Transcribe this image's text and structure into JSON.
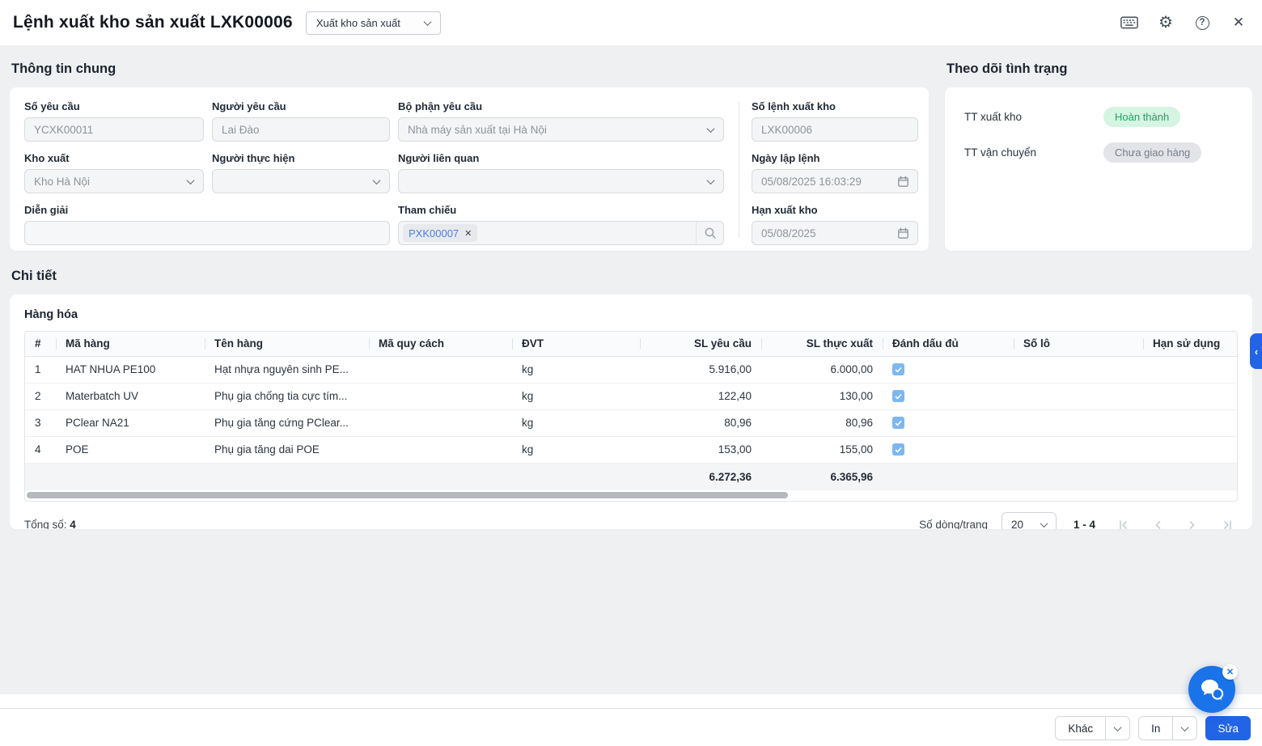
{
  "colors": {
    "primary": "#2264e5",
    "page_bg": "#eef0f2",
    "badge_green_bg": "#d5f4e2",
    "badge_green_text": "#21a263",
    "badge_gray_bg": "#e2e4e8",
    "badge_gray_text": "#767d88",
    "tag_text": "#4d7fe0",
    "checkbox_blue": "#7db7f0"
  },
  "topbar": {
    "title": "Lệnh xuất kho sản xuất LXK00006",
    "type_select_value": "Xuất kho sản xuất",
    "icons": [
      "keyboard-icon",
      "settings-icon",
      "help-icon",
      "close-icon"
    ]
  },
  "general": {
    "section_title": "Thông tin chung",
    "so_yeu_cau_label": "Số yêu cầu",
    "so_yeu_cau_value": "YCXK00011",
    "nguoi_yeu_cau_label": "Người yêu cầu",
    "nguoi_yeu_cau_value": "Lai Đào",
    "bo_phan_label": "Bộ phận yêu cầu",
    "bo_phan_value": "Nhà máy sản xuất tại Hà Nội",
    "kho_xuat_label": "Kho xuất",
    "kho_xuat_value": "Kho Hà Nội",
    "nguoi_thuc_hien_label": "Người thực hiện",
    "nguoi_thuc_hien_value": "",
    "nguoi_lien_quan_label": "Người liên quan",
    "nguoi_lien_quan_value": "",
    "dien_giai_label": "Diễn giải",
    "dien_giai_value": "",
    "tham_chieu_label": "Tham chiếu",
    "tham_chieu_tag": "PXK00007",
    "so_lenh_label": "Số lệnh xuất kho",
    "so_lenh_value": "LXK00006",
    "ngay_lap_label": "Ngày lập lệnh",
    "ngay_lap_value": "05/08/2025 16:03:29",
    "han_xuat_label": "Hạn xuất kho",
    "han_xuat_value": "05/08/2025"
  },
  "status": {
    "section_title": "Theo dõi tình trạng",
    "rows": [
      {
        "label": "TT xuất kho",
        "badge": "Hoàn thành",
        "tone": "green"
      },
      {
        "label": "TT vận chuyển",
        "badge": "Chưa giao hàng",
        "tone": "gray"
      }
    ]
  },
  "detail": {
    "section_title": "Chi tiết",
    "table_title": "Hàng hóa",
    "columns": [
      "#",
      "Mã hàng",
      "Tên hàng",
      "Mã quy cách",
      "ĐVT",
      "SL yêu cầu",
      "SL thực xuất",
      "Đánh dấu đủ",
      "Số lô",
      "Hạn sử dụng"
    ],
    "rows": [
      {
        "stt": "1",
        "ma_hang": "HAT NHUA PE100",
        "ten_hang": "Hạt nhựa nguyên sinh PE...",
        "ma_quy_cach": "",
        "dvt": "kg",
        "sl_yeu_cau": "5.916,00",
        "sl_thuc_xuat": "6.000,00",
        "danh_dau_du": true,
        "so_lo": "",
        "han_su_dung": ""
      },
      {
        "stt": "2",
        "ma_hang": "Materbatch UV",
        "ten_hang": "Phụ gia chống tia cực tím...",
        "ma_quy_cach": "",
        "dvt": "kg",
        "sl_yeu_cau": "122,40",
        "sl_thuc_xuat": "130,00",
        "danh_dau_du": true,
        "so_lo": "",
        "han_su_dung": ""
      },
      {
        "stt": "3",
        "ma_hang": "PClear NA21",
        "ten_hang": "Phụ gia tăng cứng PClear...",
        "ma_quy_cach": "",
        "dvt": "kg",
        "sl_yeu_cau": "80,96",
        "sl_thuc_xuat": "80,96",
        "danh_dau_du": true,
        "so_lo": "",
        "han_su_dung": ""
      },
      {
        "stt": "4",
        "ma_hang": "POE",
        "ten_hang": "Phụ gia tăng dai POE",
        "ma_quy_cach": "",
        "dvt": "kg",
        "sl_yeu_cau": "153,00",
        "sl_thuc_xuat": "155,00",
        "danh_dau_du": true,
        "so_lo": "",
        "han_su_dung": ""
      }
    ],
    "total_sl_yeu_cau": "6.272,36",
    "total_sl_thuc_xuat": "6.365,96"
  },
  "pagination": {
    "total_label": "Tổng số:",
    "total_value": "4",
    "per_page_label": "Số dòng/trang",
    "per_page_value": "20",
    "range_text": "1 - 4"
  },
  "footer": {
    "more_label": "Khác",
    "print_label": "In",
    "edit_label": "Sửa"
  }
}
